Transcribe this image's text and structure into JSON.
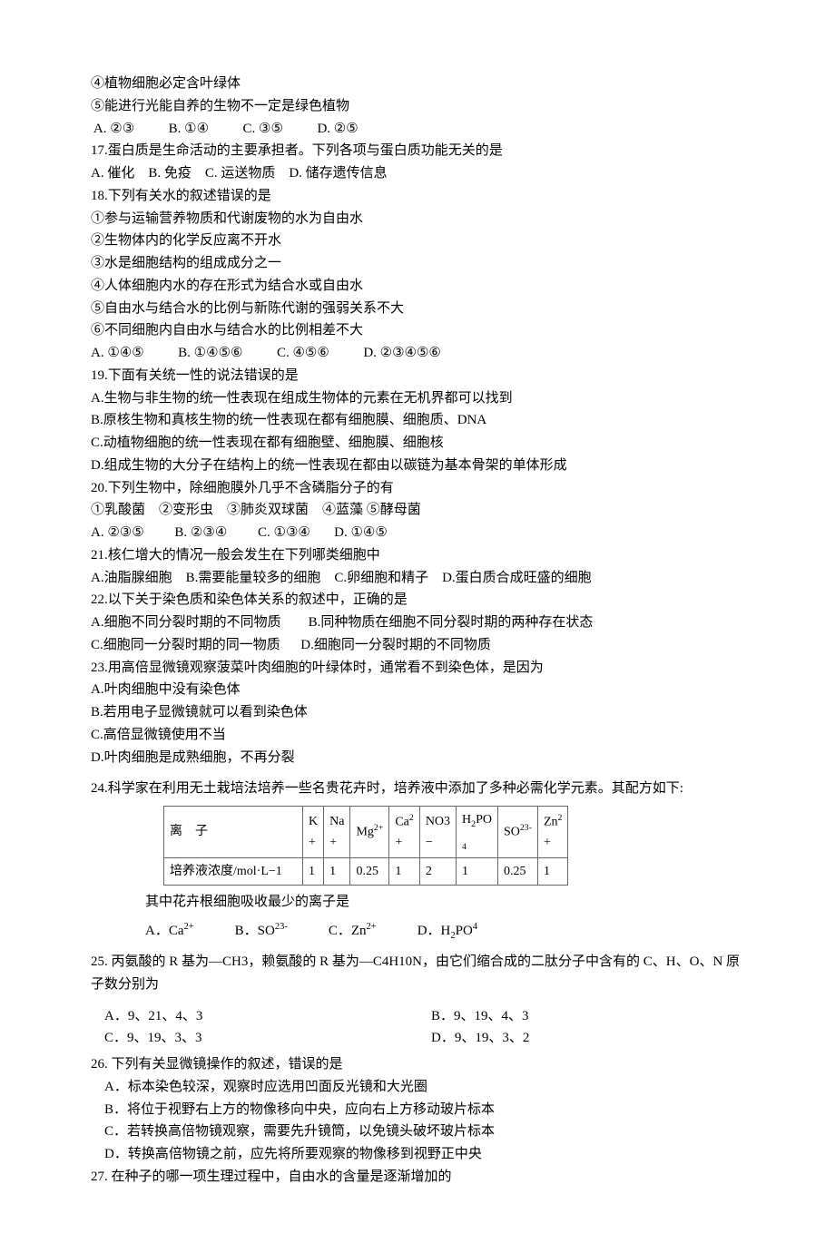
{
  "q16": {
    "s4": "④植物细胞必定含叶绿体",
    "s5": "⑤能进行光能自养的生物不一定是绿色植物",
    "opts": " A. ②③          B. ①④          C. ③⑤          D. ②⑤"
  },
  "q17": {
    "stem": "17.蛋白质是生命活动的主要承担者。下列各项与蛋白质功能无关的是",
    "opts": "A. 催化    B. 免疫    C. 运送物质    D. 储存遗传信息"
  },
  "q18": {
    "stem": "18.下列有关水的叙述错误的是",
    "s1": "①参与运输营养物质和代谢废物的水为自由水",
    "s2": "②生物体内的化学反应离不开水",
    "s3": "③水是细胞结构的组成成分之一",
    "s4": "④人体细胞内水的存在形式为结合水或自由水",
    "s5": "⑤自由水与结合水的比例与新陈代谢的强弱关系不大",
    "s6": "⑥不同细胞内自由水与结合水的比例相差不大",
    "opts": "A. ①④⑤          B. ①④⑤⑥          C. ④⑤⑥          D. ②③④⑤⑥"
  },
  "q19": {
    "stem": "19.下面有关统一性的说法错误的是",
    "a": "A.生物与非生物的统一性表现在组成生物体的元素在无机界都可以找到",
    "b": "B.原核生物和真核生物的统一性表现在都有细胞膜、细胞质、DNA",
    "c": "C.动植物细胞的统一性表现在都有细胞壁、细胞膜、细胞核",
    "d": "D.组成生物的大分子在结构上的统一性表现在都由以碳链为基本骨架的单体形成"
  },
  "q20": {
    "stem": "20.下列生物中，除细胞膜外几乎不含磷脂分子的有",
    "items": "①乳酸菌　②变形虫　③肺炎双球菌　④蓝藻 ⑤酵母菌",
    "opts": "A. ②③⑤         B. ②③④         C. ①③④       D. ①④⑤"
  },
  "q21": {
    "stem": "21.核仁增大的情况一般会发生在下列哪类细胞中",
    "opts": "A.油脂腺细胞    B.需要能量较多的细胞    C.卵细胞和精子    D.蛋白质合成旺盛的细胞"
  },
  "q22": {
    "stem": "22.以下关于染色质和染色体关系的叙述中，正确的是",
    "row1": "A.细胞不同分裂时期的不同物质        B.同种物质在细胞不同分裂时期的两种存在状态",
    "row2": "C.细胞同一分裂时期的同一物质      D.细胞同一分裂时期的不同物质"
  },
  "q23": {
    "stem": "23.用高倍显微镜观察菠菜叶肉细胞的叶绿体时，通常看不到染色体，是因为",
    "a": "A.叶肉细胞中没有染色体",
    "b": "B.若用电子显微镜就可以看到染色体",
    "c": "C.高倍显微镜使用不当",
    "d": "D.叶肉细胞是成熟细胞，不再分裂"
  },
  "q24": {
    "stem": "24.科学家在利用无土栽培法培养一些名贵花卉时，培养液中添加了多种必需化学元素。其配方如下:",
    "row_label": "离　子",
    "row2_label": "培养液浓度/mol·L−1",
    "cols": [
      "K+",
      "Na+",
      "Mg2+",
      "Ca2+",
      "NO3−",
      "H2PO4",
      "SO23-",
      "Zn2+"
    ],
    "vals": [
      "1",
      "1",
      "0.25",
      "1",
      "2",
      "1",
      "0.25",
      "1"
    ],
    "sub": "其中花卉根细胞吸收最少的离子是",
    "opts": "A．Ca2+　　　B．SO23-　　　C．Zn2+　　　D．H2PO4"
  },
  "q25": {
    "stem": "25. 丙氨酸的 R 基为—CH3，赖氨酸的 R 基为—C4H10N，由它们缩合成的二肽分子中含有的 C、H、O、N 原子数分别为",
    "a": "A．9、21、4、3",
    "b": "B．9、19、4、3",
    "c": "C．9、19、3、3",
    "d": "D．9、19、3、2"
  },
  "q26": {
    "stem": "26. 下列有关显微镜操作的叙述，错误的是",
    "a": "A．标本染色较深，观察时应选用凹面反光镜和大光圈",
    "b": "B．将位于视野右上方的物像移向中央，应向右上方移动玻片标本",
    "c": "C．若转换高倍物镜观察，需要先升镜筒，以免镜头破坏玻片标本",
    "d": "D．转换高倍物镜之前，应先将所要观察的物像移到视野正中央"
  },
  "q27": {
    "stem": "27. 在种子的哪一项生理过程中，自由水的含量是逐渐增加的"
  }
}
